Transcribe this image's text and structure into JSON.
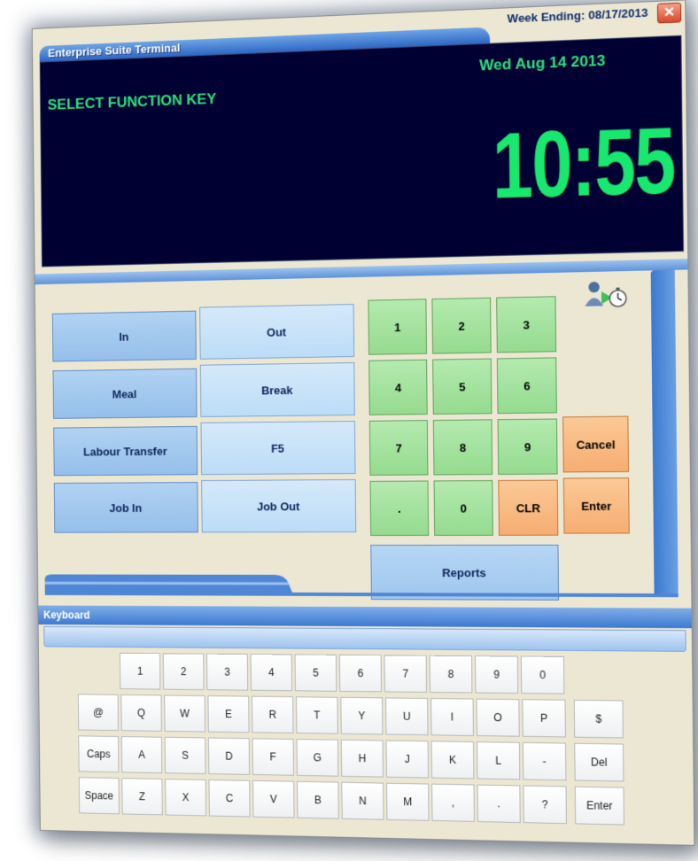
{
  "window": {
    "title": "Enterprise Suite Terminal",
    "week_ending": "Week Ending:  08/17/2013",
    "close_glyph": "✕"
  },
  "display": {
    "prompt": "SELECT FUNCTION KEY",
    "date": "Wed Aug 14 2013",
    "time": "10:55"
  },
  "function_keys": {
    "in": "In",
    "out": "Out",
    "meal": "Meal",
    "break": "Break",
    "labour_transfer": "Labour Transfer",
    "f5": "F5",
    "job_in": "Job In",
    "job_out": "Job Out",
    "reports": "Reports"
  },
  "numpad": {
    "k1": "1",
    "k2": "2",
    "k3": "3",
    "k4": "4",
    "k5": "5",
    "k6": "6",
    "k7": "7",
    "k8": "8",
    "k9": "9",
    "dot": ".",
    "k0": "0",
    "clr": "CLR",
    "cancel": "Cancel",
    "enter": "Enter"
  },
  "keyboard": {
    "header": "Keyboard",
    "row1": [
      "1",
      "2",
      "3",
      "4",
      "5",
      "6",
      "7",
      "8",
      "9",
      "0"
    ],
    "row2": [
      "@",
      "Q",
      "W",
      "E",
      "R",
      "T",
      "Y",
      "U",
      "I",
      "O",
      "P",
      "$"
    ],
    "row3": [
      "Caps",
      "A",
      "S",
      "D",
      "F",
      "G",
      "H",
      "J",
      "K",
      "L",
      "-",
      "Del"
    ],
    "row4": [
      "Space",
      "Z",
      "X",
      "C",
      "V",
      "B",
      "N",
      "M",
      ",",
      ".",
      "?",
      "Enter"
    ]
  },
  "colors": {
    "display_bg": "#000033",
    "display_text": "#2de37a",
    "numpad_green": "#95db8f",
    "action_orange": "#f6ad72",
    "function_blue": "#95bfeb",
    "accent_blue": "#3e79d0"
  },
  "icons": {
    "user_clock": "user-clock-icon",
    "close": "close-icon"
  }
}
